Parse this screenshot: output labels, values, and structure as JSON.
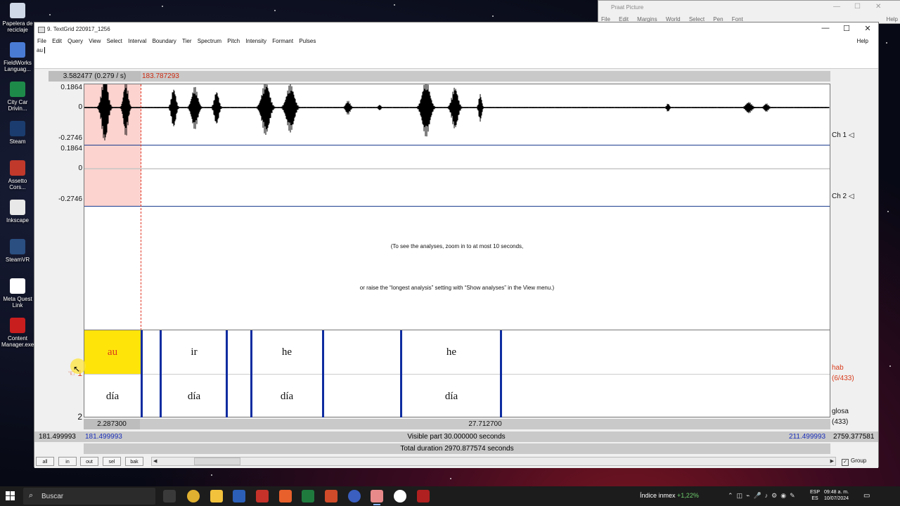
{
  "desktop": {
    "icons": [
      {
        "label": "Papelera de reciclaje",
        "color": "#cfd8e6"
      },
      {
        "label": "FieldWorks Languag...",
        "color": "#4a7bd4"
      },
      {
        "label": "City Car Drivin...",
        "color": "#1e8a4a"
      },
      {
        "label": "Steam",
        "color": "#1b3c6e"
      },
      {
        "label": "Assetto Cors...",
        "color": "#c0392b"
      },
      {
        "label": "Inkscape",
        "color": "#e8e8e8"
      },
      {
        "label": "SteamVR",
        "color": "#2a4f80"
      },
      {
        "label": "Meta Quest Link",
        "color": "#ffffff"
      },
      {
        "label": "Content Manager.exe",
        "color": "#c81e1e"
      }
    ]
  },
  "picture_window": {
    "title": "Praat Picture",
    "menu": [
      "File",
      "Edit",
      "Margins",
      "World",
      "Select",
      "Pen",
      "Font"
    ],
    "help": "Help"
  },
  "window": {
    "title": "9. TextGrid 220917_1256",
    "menu": [
      "File",
      "Edit",
      "Query",
      "View",
      "Select",
      "Interval",
      "Boundary",
      "Tier",
      "Spectrum",
      "Pitch",
      "Intensity",
      "Formant",
      "Pulses"
    ],
    "help": "Help",
    "text_value": "au"
  },
  "editor": {
    "selection_info": "3.582477 (0.279 / s)",
    "cursor_time": "183.787293",
    "channels": [
      {
        "label": "Ch 1 ◁",
        "ymax": "0.1864",
        "ymid": "0",
        "ymin": "-0.2746"
      },
      {
        "label": "Ch 2 ◁",
        "ymax": "0.1864",
        "ymid": "0",
        "ymin": "-0.2746"
      }
    ],
    "analysis_msg_1": "(To see the analyses, zoom in to at most 10 seconds,",
    "analysis_msg_2": "or raise the “longest analysis” setting with “Show analyses” in the View menu.)",
    "tiers": [
      {
        "num": "1",
        "name": "hab",
        "count": "(6/433)",
        "intervals": [
          "au",
          "ir",
          "he",
          "he"
        ]
      },
      {
        "num": "2",
        "name": "glosa",
        "count": "(433)",
        "intervals": [
          "día",
          "día",
          "día",
          "día"
        ]
      }
    ],
    "selected_tier_marker": "☜",
    "sel_duration": "2.287300",
    "rest_duration": "27.712700",
    "window_start": "181.499993",
    "window_start_blue": "181.499993",
    "visible_part": "Visible part 30.000000 seconds",
    "window_end_blue": "211.499993",
    "window_end": "2759.377581",
    "total_duration": "Total duration 2970.877574 seconds",
    "buttons": [
      "all",
      "in",
      "out",
      "sel",
      "bak"
    ],
    "group_label": "Group",
    "group_checked": true
  },
  "taskbar": {
    "search_placeholder": "Buscar",
    "ticker_label": "Índice inmex",
    "ticker_change": "+1,22%",
    "lang_top": "ESP",
    "lang_bottom": "ES",
    "time": "09:48 a. m.",
    "date": "10/07/2024"
  }
}
